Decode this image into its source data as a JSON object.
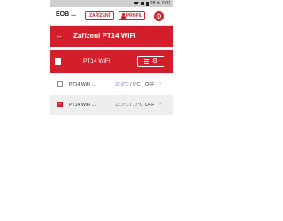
{
  "status": {
    "battery": "28 %",
    "time": "8:01"
  },
  "header": {
    "title": "EOB ...",
    "tab_devices": "ZAŘÍZENÍ",
    "tab_profile": "PROFIL"
  },
  "subheader": {
    "title": "Zařízení PT14 WiFi"
  },
  "group": {
    "label": "PT14 WiFi"
  },
  "rows": [
    {
      "name": "PT14 WiFi ...",
      "measured": "22.6°C",
      "setpoint": "5°C",
      "state": "OFF",
      "checked": false
    },
    {
      "name": "PT14 WiFi ...",
      "measured": "22.3°C",
      "setpoint": "17°C",
      "state": "OFF",
      "checked": true
    }
  ],
  "colors": {
    "accent": "#d21f2b",
    "measured_text": "#6a7fd6",
    "row_highlight": "#eeeeee"
  },
  "icons": [
    "wifi-icon",
    "signal-icon",
    "battery-icon",
    "person-icon",
    "gear-icon",
    "back-arrow-icon",
    "list-icon",
    "cog-icon",
    "chevron-right-icon",
    "check-icon"
  ]
}
